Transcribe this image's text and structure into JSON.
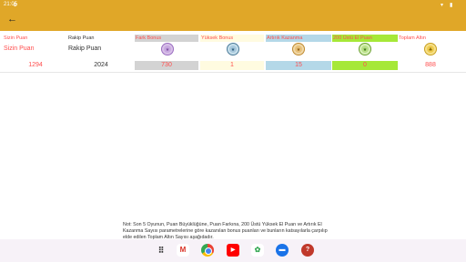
{
  "status_bar": {
    "time": "21:05"
  },
  "table": {
    "headers": {
      "your_score": "Sizin Puan",
      "opponent_score": "Rakip Puan",
      "difference_bonus": "Fark Bonus",
      "high_bonus": "Yüksek Bonus",
      "increasing_win": "Artırık Kazanma",
      "over_200": "200 Üstü El Puan",
      "total_gold": "Toplam Altın"
    },
    "labels": {
      "your_score": "Sizin Puan",
      "opponent_score": "Rakip Puan"
    },
    "values": {
      "your_score": "1294",
      "opponent_score": "2024",
      "difference_bonus": "730",
      "high_bonus": "1",
      "increasing_win": "15",
      "over_200": "0",
      "total_gold": "888"
    }
  },
  "note": "Not: Son 5 Oyunun, Puan Büyüklüğüne, Puan Farkına, 200 Üstü Yüksek El Puan ve Artırık El Kazanma Sayısı parametrelerine göre kazanılan bonus puanları ve bunların katsayılarla çarpılıp elde edilen Toplam Altın Sayısı aşağıdadır.",
  "icons": [
    "back-arrow-icon",
    "coin-icon",
    "apps-grid-icon",
    "gmail-icon",
    "chrome-icon",
    "youtube-icon",
    "photos-icon",
    "messages-icon",
    "game-app-icon"
  ],
  "colors": {
    "bar": "#e0a728",
    "accent_red": "#ff4d4d",
    "fark_bg": "#d3d3d3",
    "yuksek_bg": "#fffbe0",
    "artirik_bg": "#b4d8e8",
    "over200_bg": "#a6e838"
  }
}
